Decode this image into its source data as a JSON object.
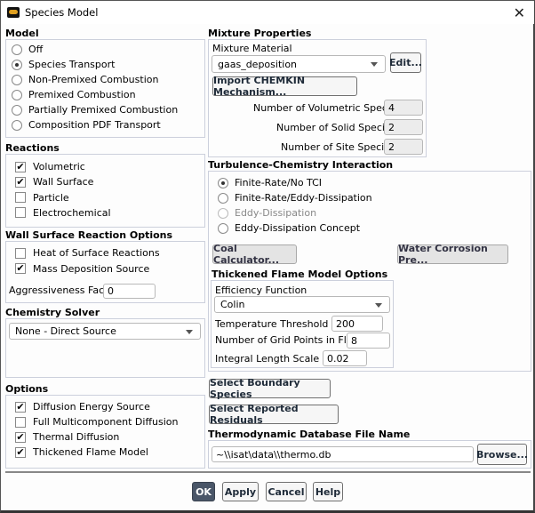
{
  "window": {
    "title": "Species Model",
    "app_icon": "fluent-app-icon",
    "close_icon": "close-icon"
  },
  "model": {
    "heading": "Model",
    "options": [
      {
        "label": "Off",
        "selected": false
      },
      {
        "label": "Species Transport",
        "selected": true
      },
      {
        "label": "Non-Premixed Combustion",
        "selected": false
      },
      {
        "label": "Premixed Combustion",
        "selected": false
      },
      {
        "label": "Partially Premixed Combustion",
        "selected": false
      },
      {
        "label": "Composition PDF Transport",
        "selected": false
      }
    ]
  },
  "reactions": {
    "heading": "Reactions",
    "items": [
      {
        "label": "Volumetric",
        "checked": true
      },
      {
        "label": "Wall Surface",
        "checked": true
      },
      {
        "label": "Particle",
        "checked": false
      },
      {
        "label": "Electrochemical",
        "checked": false
      }
    ]
  },
  "wall_surface": {
    "heading": "Wall Surface Reaction Options",
    "items": [
      {
        "label": "Heat of Surface Reactions",
        "checked": false
      },
      {
        "label": "Mass Deposition Source",
        "checked": true
      }
    ],
    "aggressiveness_label": "Aggressiveness Factor",
    "aggressiveness_value": "0"
  },
  "chemistry_solver": {
    "heading": "Chemistry Solver",
    "value": "None - Direct Source"
  },
  "options": {
    "heading": "Options",
    "items": [
      {
        "label": "Diffusion Energy Source",
        "checked": true
      },
      {
        "label": "Full Multicomponent Diffusion",
        "checked": false
      },
      {
        "label": "Thermal Diffusion",
        "checked": true
      },
      {
        "label": "Thickened Flame Model",
        "checked": true
      }
    ]
  },
  "mixture": {
    "heading": "Mixture Properties",
    "material_label": "Mixture Material",
    "material_value": "gaas_deposition",
    "edit_label": "Edit...",
    "import_label": "Import CHEMKIN Mechanism...",
    "volumetric_label": "Number of Volumetric Species",
    "volumetric_value": "4",
    "solid_label": "Number of Solid Species",
    "solid_value": "2",
    "site_label": "Number of Site Species",
    "site_value": "2"
  },
  "tci": {
    "heading": "Turbulence-Chemistry Interaction",
    "options": [
      {
        "label": "Finite-Rate/No TCI",
        "selected": true,
        "disabled": false
      },
      {
        "label": "Finite-Rate/Eddy-Dissipation",
        "selected": false,
        "disabled": false
      },
      {
        "label": "Eddy-Dissipation",
        "selected": false,
        "disabled": true
      },
      {
        "label": "Eddy-Dissipation Concept",
        "selected": false,
        "disabled": false
      }
    ],
    "coal_label": "Coal Calculator...",
    "water_label": "Water Corrosion Pre..."
  },
  "thickened": {
    "heading": "Thickened Flame Model Options",
    "efficiency_label": "Efficiency Function",
    "efficiency_value": "Colin",
    "temp_label": "Temperature Threshold [K]",
    "temp_value": "200",
    "grid_label": "Number of Grid Points in Flame",
    "grid_value": "8",
    "length_label": "Integral Length Scale [m]",
    "length_value": "0.02"
  },
  "boundary_label": "Select Boundary Species",
  "residuals_label": "Select Reported Residuals",
  "thermo": {
    "heading": "Thermodynamic Database File Name",
    "value": "~\\\\isat\\data\\\\thermo.db",
    "browse_label": "Browse..."
  },
  "footer": {
    "ok": "OK",
    "apply": "Apply",
    "cancel": "Cancel",
    "help": "Help"
  }
}
